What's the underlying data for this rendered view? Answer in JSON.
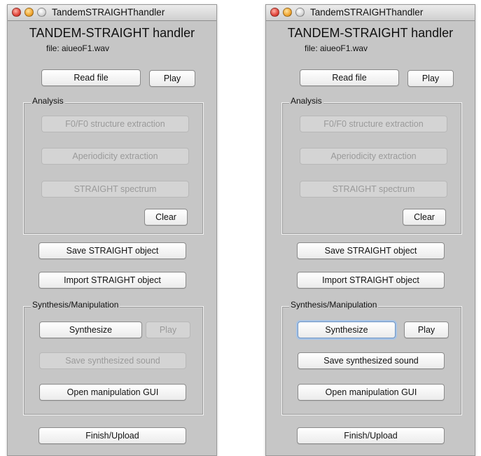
{
  "windows": [
    {
      "window_title": "TandemSTRAIGHThandler",
      "app_title": "TANDEM-STRAIGHT handler",
      "file_info": "file: aiueoF1.wav",
      "read_file": "Read file",
      "play": "Play",
      "analysis_label": "Analysis",
      "f0_extraction": "F0/F0 structure extraction",
      "aperiodicity": "Aperiodicity extraction",
      "spectrum": "STRAIGHT spectrum",
      "clear": "Clear",
      "save_object": "Save STRAIGHT object",
      "import_object": "Import STRAIGHT object",
      "synthesis_label": "Synthesis/Manipulation",
      "synthesize": "Synthesize",
      "synth_play": "Play",
      "save_sound": "Save synthesized sound",
      "open_gui": "Open manipulation GUI",
      "finish": "Finish/Upload"
    },
    {
      "window_title": "TandemSTRAIGHThandler",
      "app_title": "TANDEM-STRAIGHT handler",
      "file_info": "file: aiueoF1.wav",
      "read_file": "Read file",
      "play": "Play",
      "analysis_label": "Analysis",
      "f0_extraction": "F0/F0 structure extraction",
      "aperiodicity": "Aperiodicity extraction",
      "spectrum": "STRAIGHT spectrum",
      "clear": "Clear",
      "save_object": "Save STRAIGHT object",
      "import_object": "Import STRAIGHT object",
      "synthesis_label": "Synthesis/Manipulation",
      "synthesize": "Synthesize",
      "synth_play": "Play",
      "save_sound": "Save synthesized sound",
      "open_gui": "Open manipulation GUI",
      "finish": "Finish/Upload"
    }
  ]
}
